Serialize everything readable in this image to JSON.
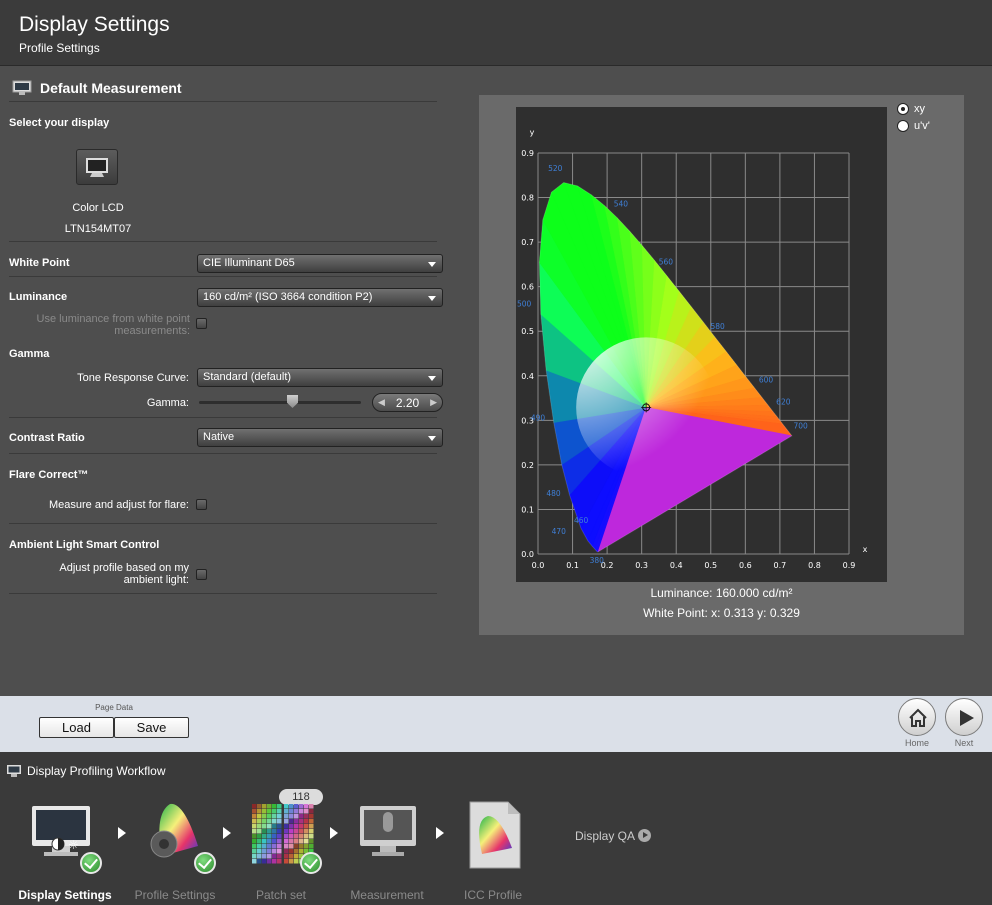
{
  "header": {
    "title": "Display Settings",
    "subtitle": "Profile Settings"
  },
  "measurement": {
    "section_title": "Default Measurement",
    "select_display_label": "Select your display",
    "display_name": "Color LCD",
    "display_model": "LTN154MT07",
    "white_point_label": "White Point",
    "white_point_value": "CIE Illuminant D65",
    "luminance_label": "Luminance",
    "luminance_value": "160 cd/m² (ISO 3664 condition P2)",
    "use_luminance_line1": "Use luminance from white point",
    "use_luminance_line2": "measurements:",
    "gamma_section": "Gamma",
    "tone_curve_label": "Tone Response Curve:",
    "tone_curve_value": "Standard (default)",
    "gamma_label": "Gamma:",
    "gamma_value": "2.20",
    "gamma_slider_fraction": 0.58,
    "contrast_label": "Contrast Ratio",
    "contrast_value": "Native",
    "flare_label": "Flare Correct™",
    "flare_option": "Measure and adjust for flare:",
    "ambient_label": "Ambient Light Smart Control",
    "ambient_option_line1": "Adjust profile based on my",
    "ambient_option_line2": "ambient light:"
  },
  "chart_panel": {
    "radio_xy": "xy",
    "radio_uv": "u'v'",
    "selected": "xy",
    "luminance_caption": "Luminance: 160.000 cd/m²",
    "white_point_caption": "White Point: x: 0.313  y: 0.329"
  },
  "chart_data": {
    "type": "scatter",
    "xlabel": "x",
    "ylabel": "y",
    "xlim": [
      0.0,
      0.9
    ],
    "ylim": [
      0.0,
      0.9
    ],
    "x_ticks": [
      "0.0",
      "0.1",
      "0.2",
      "0.3",
      "0.4",
      "0.5",
      "0.6",
      "0.7",
      "0.8",
      "0.9"
    ],
    "y_ticks": [
      "0.0",
      "0.1",
      "0.2",
      "0.3",
      "0.4",
      "0.5",
      "0.6",
      "0.7",
      "0.8",
      "0.9"
    ],
    "grid": true,
    "wavelength_labels": [
      {
        "label": "380",
        "x": 0.17,
        "y": -0.02
      },
      {
        "label": "460",
        "x": 0.125,
        "y": 0.07
      },
      {
        "label": "470",
        "x": 0.06,
        "y": 0.045
      },
      {
        "label": "480",
        "x": 0.045,
        "y": 0.13
      },
      {
        "label": "490",
        "x": 0.0,
        "y": 0.3
      },
      {
        "label": "500",
        "x": -0.04,
        "y": 0.555
      },
      {
        "label": "520",
        "x": 0.05,
        "y": 0.86
      },
      {
        "label": "540",
        "x": 0.24,
        "y": 0.78
      },
      {
        "label": "560",
        "x": 0.37,
        "y": 0.65
      },
      {
        "label": "580",
        "x": 0.52,
        "y": 0.505
      },
      {
        "label": "600",
        "x": 0.66,
        "y": 0.385
      },
      {
        "label": "620",
        "x": 0.71,
        "y": 0.335
      },
      {
        "label": "700",
        "x": 0.76,
        "y": 0.282
      }
    ],
    "white_point": {
      "x": 0.313,
      "y": 0.329
    }
  },
  "navbar": {
    "page_data_label": "Page Data",
    "load_label": "Load",
    "save_label": "Save",
    "home_label": "Home",
    "next_label": "Next"
  },
  "workflow": {
    "title": "Display Profiling Workflow",
    "steps": [
      {
        "label": "Display Settings",
        "done": true
      },
      {
        "label": "Profile Settings",
        "done": true
      },
      {
        "label": "Patch set",
        "done": true
      },
      {
        "label": "Measurement",
        "done": false
      },
      {
        "label": "ICC Profile",
        "done": false
      }
    ],
    "patch_count": "118",
    "qa_label": "Display QA"
  },
  "colors": {
    "header_bg": "#3b3b3b",
    "panel_bg": "#4e4e4e",
    "navbar_bg": "#dbe0e8",
    "accent_check": "#2a8a2a"
  }
}
